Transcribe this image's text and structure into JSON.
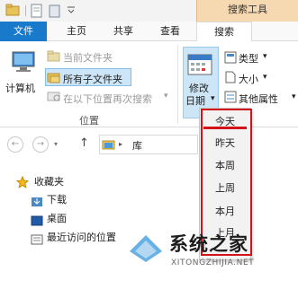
{
  "title_bar": {
    "context_group": "搜索工具"
  },
  "tabs": [
    {
      "label": "文件",
      "active": false
    },
    {
      "label": "主页",
      "active": false
    },
    {
      "label": "共享",
      "active": false
    },
    {
      "label": "查看",
      "active": false
    },
    {
      "label": "搜索",
      "active": true
    }
  ],
  "ribbon": {
    "computer": "计算机",
    "current_folder": "当前文件夹",
    "all_subfolders": "所有子文件夹",
    "search_again_in": "在以下位置再次搜索",
    "location_group": "位置",
    "modify_date_line1": "修改",
    "modify_date_line2": "日期",
    "type": "类型",
    "size": "大小",
    "other_properties": "其他属性"
  },
  "address": {
    "path": "库"
  },
  "nav_tree": {
    "favorites": "收藏夹",
    "downloads": "下载",
    "desktop": "桌面",
    "recent_places": "最近访问的位置"
  },
  "date_menu": {
    "items": [
      "今天",
      "昨天",
      "本周",
      "上周",
      "本月",
      "上月"
    ],
    "selected": "今天"
  },
  "watermark": {
    "brand": "系统之家",
    "url": "XITONGZHIJIA.NET"
  },
  "colors": {
    "file_tab": "#1979ca",
    "context_header": "#f7d9b1",
    "annotation_red": "#d2141a",
    "selected_button": "#cde6f7"
  }
}
